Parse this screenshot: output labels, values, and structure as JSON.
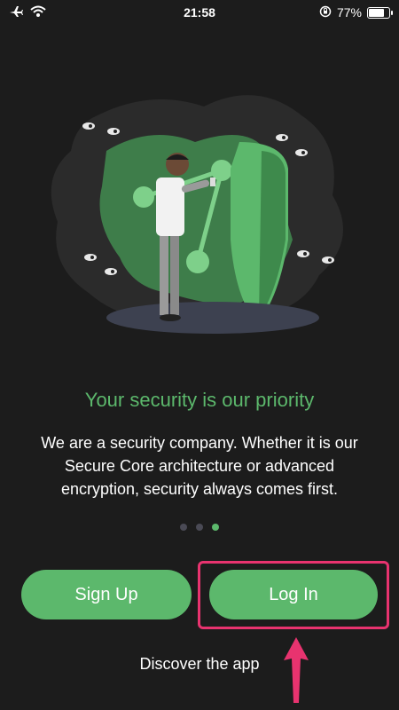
{
  "status_bar": {
    "time": "21:58",
    "battery_percent": "77%",
    "battery_level": 0.77,
    "icons": [
      "airplane-icon",
      "wifi-icon",
      "screen-lock-rotation-icon",
      "battery-icon"
    ]
  },
  "onboarding": {
    "headline": "Your security is our priority",
    "body": "We are a security company. Whether it is our Secure Core architecture or advanced encryption, security always comes first.",
    "page_count": 3,
    "active_page": 3
  },
  "actions": {
    "signup_label": "Sign Up",
    "login_label": "Log In",
    "discover_label": "Discover the app"
  },
  "colors": {
    "background": "#1c1c1c",
    "accent_green": "#5cb86c",
    "highlight_pink": "#e8336f",
    "inactive_dot": "#4a4a55"
  }
}
